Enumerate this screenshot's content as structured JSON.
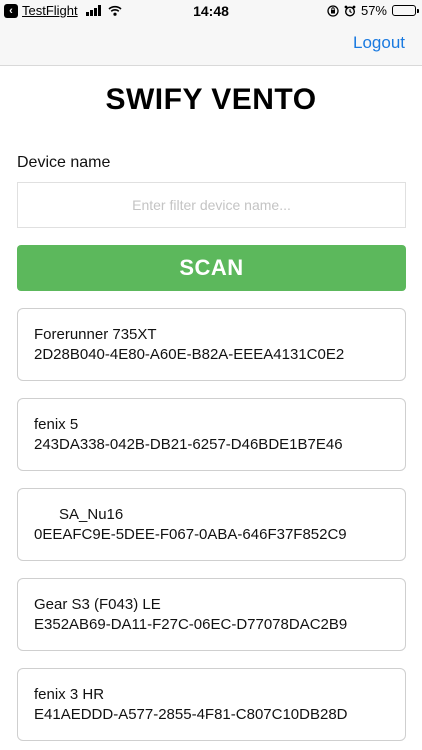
{
  "status_bar": {
    "back_app": "TestFlight",
    "time": "14:48",
    "battery": "57%",
    "battery_level": 0.57,
    "icons": [
      "back-arrow-icon",
      "signal-icon",
      "wifi-icon",
      "orientation-lock-icon",
      "alarm-icon",
      "battery-icon"
    ]
  },
  "nav": {
    "logout_label": "Logout"
  },
  "app_title": "SWIFY VENTO",
  "filter": {
    "label": "Device name",
    "placeholder": "Enter filter device name...",
    "value": ""
  },
  "scan_label": "SCAN",
  "colors": {
    "accent": "#1a7ae0",
    "scan_button": "#5cb85c"
  },
  "devices": [
    {
      "name": "Forerunner 735XT",
      "id": "2D28B040-4E80-A60E-B82A-EEEA4131C0E2"
    },
    {
      "name": "fenix 5",
      "id": "243DA338-042B-DB21-6257-D46BDE1B7E46"
    },
    {
      "name": "      SA_Nu16",
      "id": "0EEAFC9E-5DEE-F067-0ABA-646F37F852C9"
    },
    {
      "name": "Gear S3 (F043) LE",
      "id": "E352AB69-DA11-F27C-06EC-D77078DAC2B9"
    },
    {
      "name": "fenix 3 HR",
      "id": "E41AEDDD-A577-2855-4F81-C807C10DB28D"
    }
  ]
}
